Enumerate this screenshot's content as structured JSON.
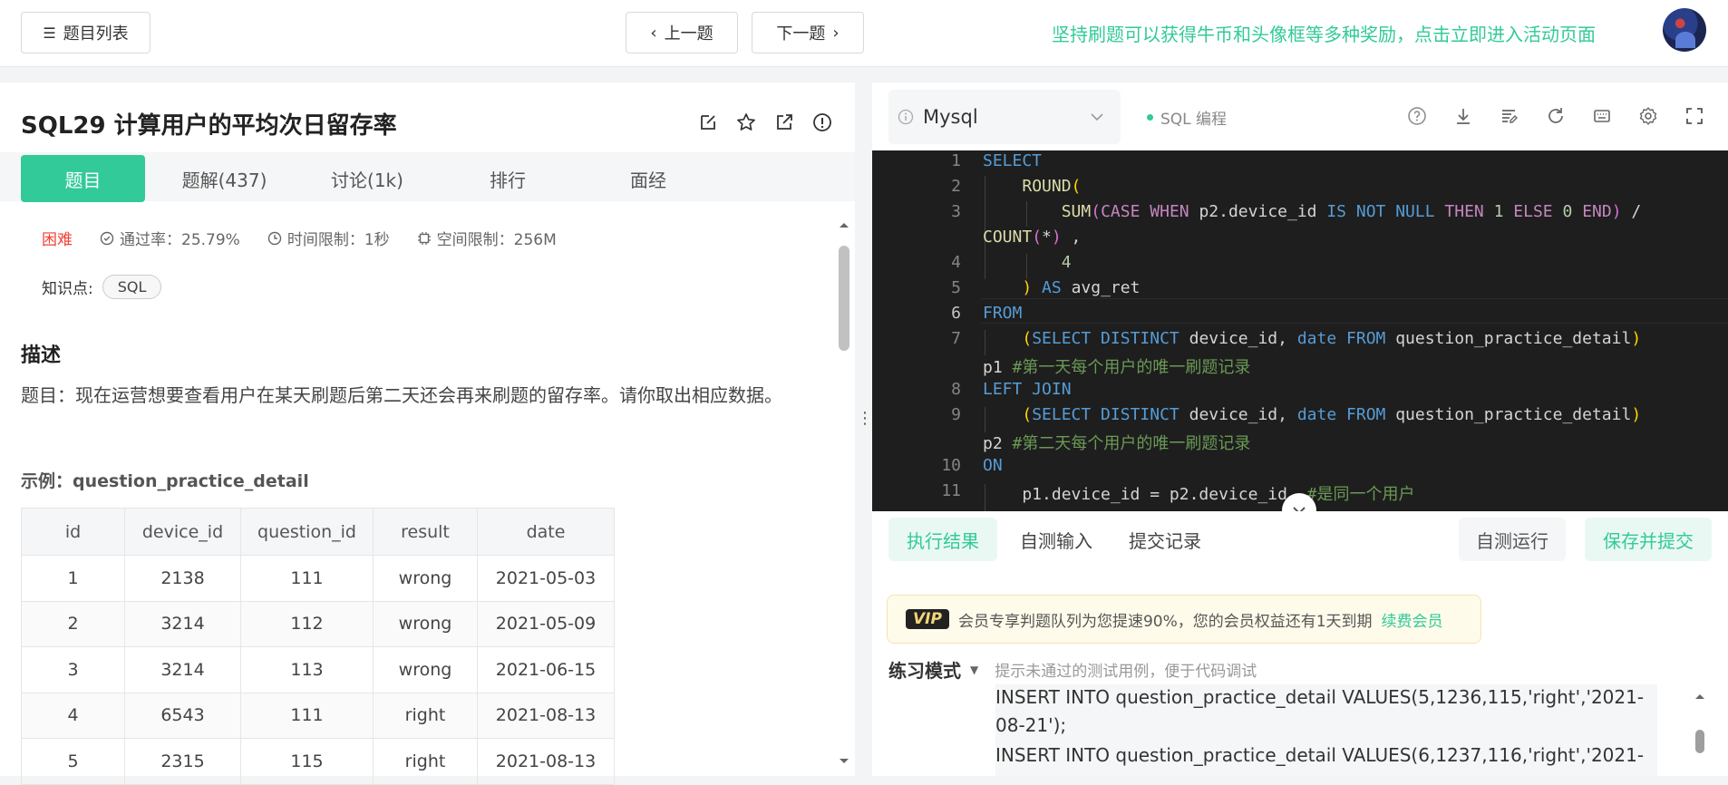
{
  "topbar": {
    "list_label": "题目列表",
    "prev_label": "上一题",
    "next_label": "下一题",
    "promo_text": "坚持刷题可以获得牛币和头像框等多种奖励，点击立即进入活动页面"
  },
  "problem": {
    "title": "SQL29  计算用户的平均次日留存率",
    "tabs": [
      "题目",
      "题解(437)",
      "讨论(1k)",
      "排行",
      "面经"
    ],
    "difficulty": "困难",
    "pass_rate": "通过率：25.79%",
    "time_limit": "时间限制：1秒",
    "space_limit": "空间限制：256M",
    "knowledge_label": "知识点:",
    "knowledge_tag": "SQL",
    "desc_heading": "描述",
    "desc_text": "题目：现在运营想要查看用户在某天刷题后第二天还会再来刷题的留存率。请你取出相应数据。",
    "example_label": "示例：question_practice_detail",
    "table": {
      "headers": [
        "id",
        "device_id",
        "question_id",
        "result",
        "date"
      ],
      "rows": [
        [
          "1",
          "2138",
          "111",
          "wrong",
          "2021-05-03"
        ],
        [
          "2",
          "3214",
          "112",
          "wrong",
          "2021-05-09"
        ],
        [
          "3",
          "3214",
          "113",
          "wrong",
          "2021-06-15"
        ],
        [
          "4",
          "6543",
          "111",
          "right",
          "2021-08-13"
        ],
        [
          "5",
          "2315",
          "115",
          "right",
          "2021-08-13"
        ]
      ]
    }
  },
  "editor": {
    "language": "Mysql",
    "mode": "SQL 编程",
    "line_numbers": [
      "1",
      "2",
      "3",
      "",
      "4",
      "5",
      "6",
      "7",
      "",
      "8",
      "9",
      "",
      "10",
      "11"
    ]
  },
  "result": {
    "tabs": [
      "执行结果",
      "自测输入",
      "提交记录"
    ],
    "run_label": "自测运行",
    "submit_label": "保存并提交",
    "vip_badge": "VIP",
    "vip_text": "会员专享判题队列为您提速90%，您的会员权益还有1天到期",
    "vip_renew": "续费会员",
    "practice_mode": "练习模式",
    "practice_tip": "提示未通过的测试用例，便于代码调试",
    "console_lines": [
      "INSERT INTO question_practice_detail VALUES(5,1236,115,'right','2021-",
      "08-21');",
      "INSERT INTO question_practice_detail VALUES(6,1237,116,'right','2021-"
    ]
  }
}
